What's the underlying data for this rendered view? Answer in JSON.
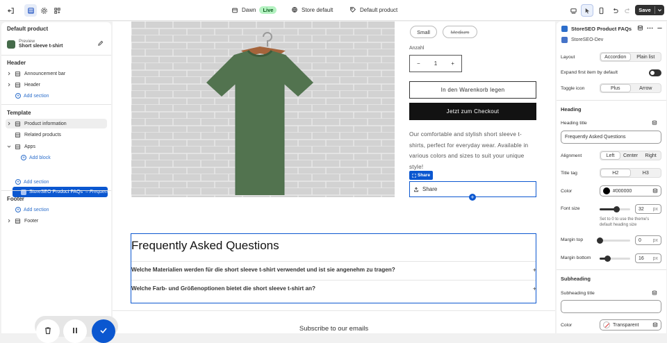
{
  "topbar": {
    "store_name": "Dawn",
    "live_badge": "Live",
    "store_default": "Store default",
    "product_default": "Default product",
    "save_label": "Save"
  },
  "left_panel": {
    "title": "Default product",
    "preview_label": "Preview",
    "preview_product": "Short sleeve t-shirt",
    "header_group": "Header",
    "header_items": [
      "Announcement bar",
      "Header"
    ],
    "add_section": "Add section",
    "template_group": "Template",
    "template_items": [
      "Product information",
      "Related products",
      "Apps"
    ],
    "add_block": "Add block",
    "selected_block": "StoreSEO Product FAQs",
    "selected_block_sub": "– Frequen",
    "footer_group": "Footer",
    "footer_items": [
      "Footer"
    ]
  },
  "preview": {
    "variant_options": [
      "Small",
      "Medium"
    ],
    "quantity_label": "Anzahl",
    "quantity_value": "1",
    "qty_minus": "−",
    "qty_plus": "+",
    "add_to_cart": "In den Warenkorb legen",
    "checkout": "Jetzt zum Checkout",
    "description": "Our comfortable and stylish short sleeve t-shirts, perfect for everyday wear. Available in various colors and sizes to suit your unique style!",
    "share_tag": "Share",
    "share_label": "Share",
    "faq_heading": "Frequently Asked Questions",
    "faq_questions": [
      "Welche Materialien werden für die short sleeve t-shirt verwendet und ist sie angenehm zu tragen?",
      "Welche Farb- und Größenoptionen bietet die short sleeve t-shirt an?"
    ],
    "faq_expand": "+",
    "subscribe": "Subscribe to our emails"
  },
  "right_panel": {
    "title": "StoreSEO Product FAQs",
    "app_name": "StoreSEO-Dev",
    "layout_label": "Layout",
    "layout_options": [
      "Accordion",
      "Plain list"
    ],
    "expand_label": "Expand first item by default",
    "expand_on": true,
    "toggle_icon_label": "Toggle icon",
    "toggle_icon_options": [
      "Plus",
      "Arrow"
    ],
    "heading_section": "Heading",
    "heading_title_label": "Heading title",
    "heading_title_value": "Frequently Asked Questions",
    "alignment_label": "Alignment",
    "alignment_options": [
      "Left",
      "Center",
      "Right"
    ],
    "title_tag_label": "Title tag",
    "title_tag_options": [
      "H2",
      "H3"
    ],
    "color_label": "Color",
    "color_value": "#000000",
    "font_size_label": "Font size",
    "font_size_value": "32",
    "font_size_unit": "px",
    "font_size_fraction": 0.55,
    "font_size_hint": "Set to 0 to use the theme's default heading size",
    "margin_top_label": "Margin top",
    "margin_top_value": "0",
    "margin_top_fraction": 0.0,
    "margin_bottom_label": "Margin bottom",
    "margin_bottom_value": "16",
    "margin_bottom_fraction": 0.27,
    "unit": "px",
    "subheading_section": "Subheading",
    "subheading_title_label": "Subheading title",
    "subheading_title_value": "",
    "sub_color_label": "Color",
    "sub_color_value": "Transparent"
  },
  "colors": {
    "accent": "#0b57d0",
    "tshirt": "#52734f",
    "live_bg": "#b4f2c1",
    "checkout_bg": "#121212"
  }
}
